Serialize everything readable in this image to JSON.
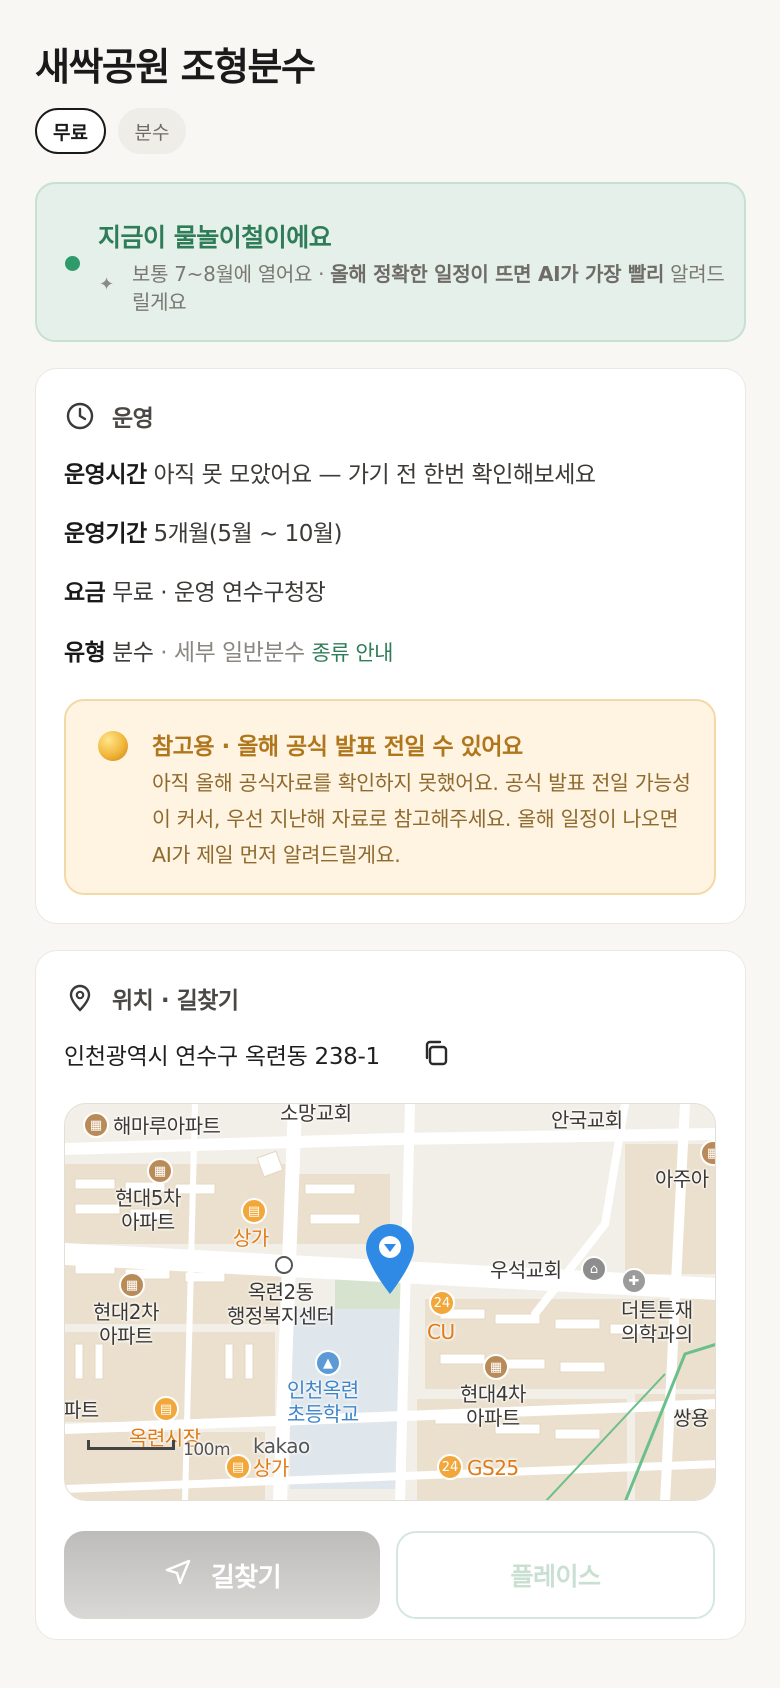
{
  "header": {
    "title": "새싹공원 조형분수",
    "chips": [
      "무료",
      "분수"
    ]
  },
  "season": {
    "title": "지금이 물놀이철이에요",
    "desc_prefix": "보통 7~8월에 열어요 · ",
    "desc_bold": "올해 정확한 일정이 뜨면 AI가 가장 빨리",
    "desc_suffix": "알려드릴게요",
    "accent": "#2f9a6b"
  },
  "operation": {
    "title": "운영",
    "rows": [
      {
        "key": "운영시간",
        "value": "아직 못 모았어요 — 가기 전 한번 확인해보세요"
      },
      {
        "key": "운영기간",
        "value": "5개월(5월 ~ 10월)"
      },
      {
        "key": "요금",
        "value": "무료 · 운영 연수구청장"
      }
    ],
    "type_key": "유형",
    "type_value": "분수",
    "type_sub": "· 세부 일반분수",
    "type_link": "종류 안내",
    "notice": {
      "title": "참고용 · 올해 공식 발표 전일 수 있어요",
      "body": "아직 올해 공식자료를 확인하지 못했어요. 공식 발표 전일 가능성이 커서, 우선 지난해 자료로 참고해주세요. 올해 일정이 나오면 AI가 제일 먼저 알려드릴게요."
    }
  },
  "location": {
    "title": "위치 · 길찾기",
    "address": "인천광역시 연수구 옥련동 238-1",
    "map": {
      "labels": {
        "apt1": "해마루아파트",
        "church1": "소망교회",
        "church2": "안국교회",
        "apt_edge": "아주아",
        "apt2": "현대5차\n아파트",
        "shop1": "상가",
        "office": "옥련2동\n행정복지센터",
        "church3": "우석교회",
        "hosp": "더튼튼재\n의학과의",
        "apt3": "현대2차\n아파트",
        "cu": "CU",
        "school": "인천옥련\n초등학교",
        "apt4": "현대4차\n아파트",
        "apt_left": "파트",
        "market": "옥련시장",
        "ssang": "쌍용",
        "scale": "100m",
        "brand": "kakao",
        "shop2": "상가",
        "gs": "GS25"
      }
    },
    "buttons": {
      "navigate": "길찾기",
      "place": "플레이스"
    }
  }
}
